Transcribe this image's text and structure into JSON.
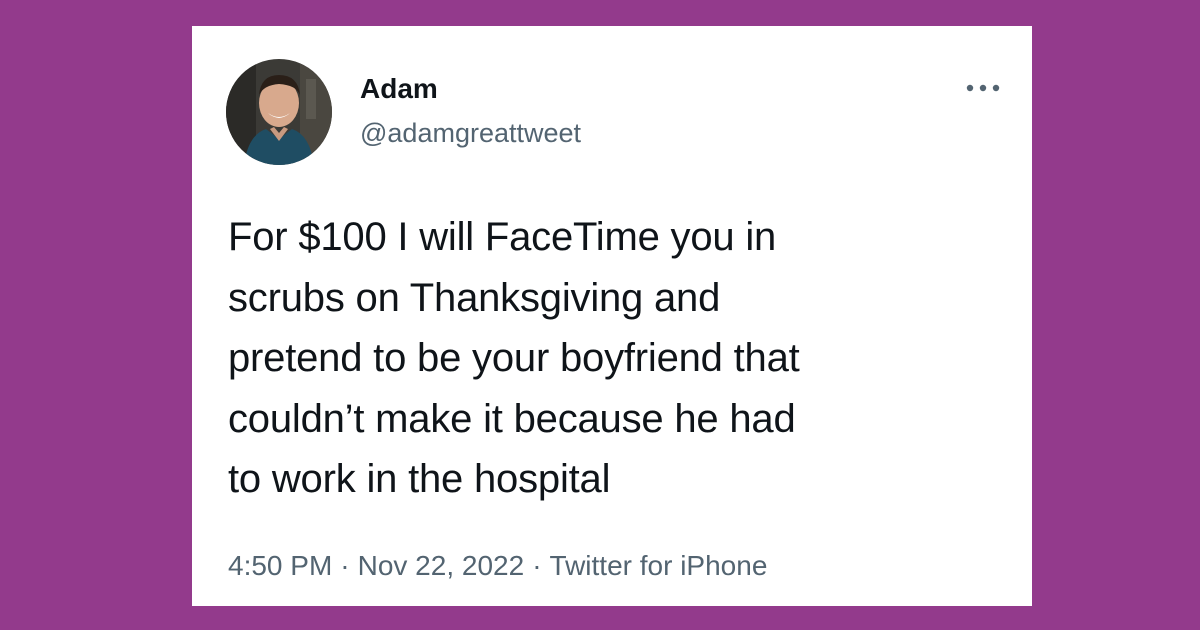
{
  "colors": {
    "background": "#933a8c",
    "card": "#ffffff",
    "primary_text": "#0f1419",
    "secondary_text": "#536471"
  },
  "tweet": {
    "author": {
      "display_name": "Adam",
      "handle": "@adamgreattweet",
      "avatar_icon": "profile-photo"
    },
    "more_icon": "ellipsis-icon",
    "text": "For $100 I will FaceTime you in\nscrubs on Thanksgiving and\npretend to be your boyfriend that\ncouldn’t make it because he had\nto work in the hospital",
    "time": "4:50 PM",
    "separator": "·",
    "date": "Nov 22, 2022",
    "source": "Twitter for iPhone"
  }
}
